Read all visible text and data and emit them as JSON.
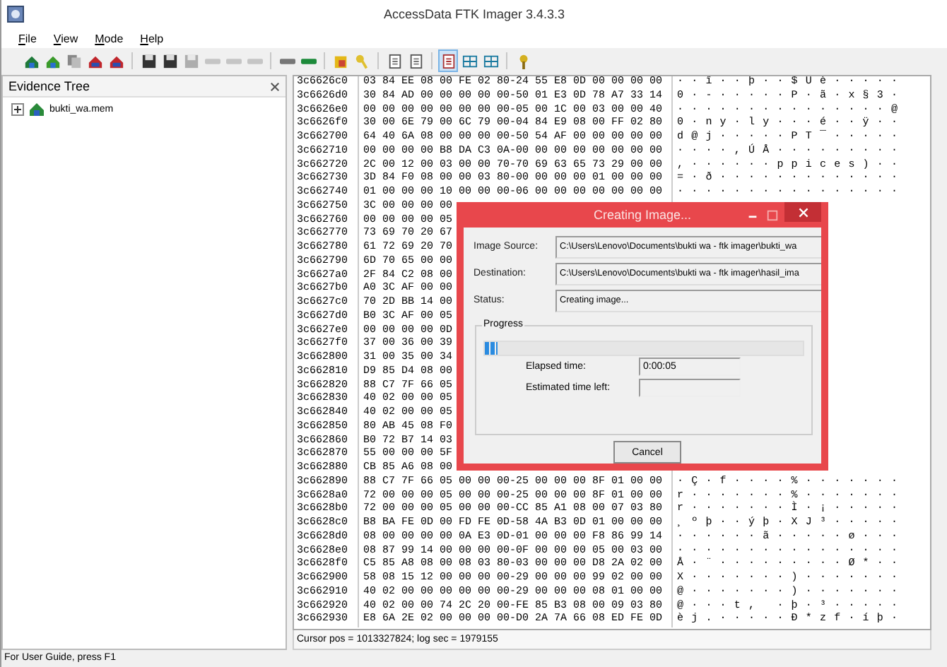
{
  "window": {
    "title": "AccessData FTK Imager 3.4.3.3"
  },
  "menu": [
    "File",
    "View",
    "Mode",
    "Help"
  ],
  "toolbar": [
    {
      "disabled": false,
      "selected": false
    },
    {
      "disabled": false,
      "selected": false
    },
    {
      "disabled": false,
      "selected": false
    },
    {
      "disabled": false,
      "selected": false
    },
    {
      "disabled": false,
      "selected": false
    },
    {
      "disabled": false,
      "selected": false
    },
    {
      "disabled": false,
      "selected": false
    },
    {
      "disabled": true,
      "selected": false
    },
    {
      "disabled": true,
      "selected": false
    },
    {
      "disabled": true,
      "selected": false
    },
    {
      "disabled": true,
      "selected": false
    },
    {
      "disabled": false,
      "selected": false
    },
    {
      "disabled": false,
      "selected": false
    },
    {
      "disabled": false,
      "selected": false
    },
    {
      "disabled": false,
      "selected": false
    },
    {
      "disabled": false,
      "selected": false
    },
    {
      "disabled": false,
      "selected": false
    },
    {
      "disabled": false,
      "selected": true
    },
    {
      "disabled": false,
      "selected": false
    },
    {
      "disabled": false,
      "selected": false
    },
    {
      "disabled": false,
      "selected": false
    }
  ],
  "evidence_tree": {
    "title": "Evidence Tree",
    "items": [
      {
        "label": "bukti_wa.mem",
        "expanded": false
      }
    ]
  },
  "hex_rows": [
    {
      "address": "3c6626c0",
      "hex": "03 84 EE 08 00 FE 02 80-24 55 E8 0D 00 00 00 00",
      "ascii": "··î··þ··$Uè·····"
    },
    {
      "address": "3c6626d0",
      "hex": "30 84 AD 00 00 00 00 00-50 01 E3 0D 78 A7 33 14",
      "ascii": "0·-·····P·ã·x§3·"
    },
    {
      "address": "3c6626e0",
      "hex": "00 00 00 00 00 00 00 00-05 00 1C 00 03 00 00 40",
      "ascii": "···············@"
    },
    {
      "address": "3c6626f0",
      "hex": "30 00 6E 79 00 6C 79 00-04 84 E9 08 00 FF 02 80",
      "ascii": "0·ny·ly···é··ÿ··"
    },
    {
      "address": "3c662700",
      "hex": "64 40 6A 08 00 00 00 00-50 54 AF 00 00 00 00 00",
      "ascii": "d@j·····PT¯·····"
    },
    {
      "address": "3c662710",
      "hex": "00 00 00 00 B8 DA C3 0A-00 00 00 00 00 00 00 00",
      "ascii": "····,ÚÅ·········"
    },
    {
      "address": "3c662720",
      "hex": "2C 00 12 00 03 00 00 70-70 69 63 65 73 29 00 00",
      "ascii": ",······ppices)··"
    },
    {
      "address": "3c662730",
      "hex": "3D 84 F0 08 00 00 03 80-00 00 00 00 01 00 00 00",
      "ascii": "=·ð·············"
    },
    {
      "address": "3c662740",
      "hex": "01 00 00 00 10 00 00 00-06 00 00 00 00 00 00 00",
      "ascii": "················"
    },
    {
      "address": "3c662750",
      "hex": "3C 00 00 00 00"
    },
    {
      "address": "3c662760",
      "hex": "00 00 00 00 05"
    },
    {
      "address": "3c662770",
      "hex": "73 69 70 20 67"
    },
    {
      "address": "3c662780",
      "hex": "61 72 69 20 70"
    },
    {
      "address": "3c662790",
      "hex": "6D 70 65 00 00"
    },
    {
      "address": "3c6627a0",
      "hex": "2F 84 C2 08 00"
    },
    {
      "address": "3c6627b0",
      "hex": "A0 3C AF 00 00"
    },
    {
      "address": "3c6627c0",
      "hex": "70 2D BB 14 00"
    },
    {
      "address": "3c6627d0",
      "hex": "B0 3C AF 00 05"
    },
    {
      "address": "3c6627e0",
      "hex": "00 00 00 00 0D"
    },
    {
      "address": "3c6627f0",
      "hex": "37 00 36 00 39"
    },
    {
      "address": "3c662800",
      "hex": "31 00 35 00 34"
    },
    {
      "address": "3c662810",
      "hex": "D9 85 D4 08 00"
    },
    {
      "address": "3c662820",
      "hex": "88 C7 7F 66 05"
    },
    {
      "address": "3c662830",
      "hex": "40 02 00 00 05"
    },
    {
      "address": "3c662840",
      "hex": "40 02 00 00 05"
    },
    {
      "address": "3c662850",
      "hex": "80 AB 45 08 F0"
    },
    {
      "address": "3c662860",
      "hex": "B0 72 B7 14 03"
    },
    {
      "address": "3c662870",
      "hex": "55 00 00 00 5F"
    },
    {
      "address": "3c662880",
      "hex": "CB 85 A6 08 00"
    },
    {
      "address": "3c662890",
      "hex": "88 C7 7F 66 05 00 00 00-25 00 00 00 8F 01 00 00",
      "ascii": "·Ç·f····%·······"
    },
    {
      "address": "3c6628a0",
      "hex": "72 00 00 00 05 00 00 00-25 00 00 00 8F 01 00 00",
      "ascii": "r·······%·······"
    },
    {
      "address": "3c6628b0",
      "hex": "72 00 00 00 05 00 00 00-CC 85 A1 08 00 07 03 80",
      "ascii": "r·······Ì·¡·····"
    },
    {
      "address": "3c6628c0",
      "hex": "B8 BA FE 0D 00 FD FE 0D-58 4A B3 0D 01 00 00 00",
      "ascii": "¸ºþ··ýþ·XJ³·····"
    },
    {
      "address": "3c6628d0",
      "hex": "08 00 00 00 00 0A E3 0D-01 00 00 00 F8 86 99 14",
      "ascii": "······ã·····ø···"
    },
    {
      "address": "3c6628e0",
      "hex": "08 87 99 14 00 00 00 00-0F 00 00 00 05 00 03 00",
      "ascii": "················"
    },
    {
      "address": "3c6628f0",
      "hex": "C5 85 A8 08 00 08 03 80-03 00 00 00 D8 2A 02 00",
      "ascii": "Å·¨·········Ø*··"
    },
    {
      "address": "3c662900",
      "hex": "58 08 15 12 00 00 00 00-29 00 00 00 99 02 00 00",
      "ascii": "X·······)·······"
    },
    {
      "address": "3c662910",
      "hex": "40 02 00 00 00 00 00 00-29 00 00 00 08 01 00 00",
      "ascii": "@·······)·······"
    },
    {
      "address": "3c662920",
      "hex": "40 02 00 00 74 2C 20 00-FE 85 B3 08 00 09 03 80",
      "ascii": "@···t, ·þ·³·····"
    },
    {
      "address": "3c662930",
      "hex": "E8 6A 2E 02 00 00 00 00-D0 2A 7A 66 08 ED FE 0D",
      "ascii": "èj.·····Ð*zf·íþ·"
    }
  ],
  "cursor_info": "Cursor pos = 1013327824; log sec = 1979155",
  "status_bar": "For User Guide, press F1",
  "dialog": {
    "title": "Creating Image...",
    "fields": [
      {
        "label": "Image Source:",
        "value": "C:\\Users\\Lenovo\\Documents\\bukti wa - ftk imager\\bukti_wa"
      },
      {
        "label": "Destination:",
        "value": "C:\\Users\\Lenovo\\Documents\\bukti wa - ftk imager\\hasil_ima"
      },
      {
        "label": "Status:",
        "value": "Creating image..."
      }
    ],
    "progress": {
      "title": "Progress",
      "level": 0.04
    },
    "times": [
      {
        "label": "Elapsed time:",
        "value": "0:00:05"
      },
      {
        "label": "Estimated time left:"
      }
    ],
    "button": "Cancel"
  }
}
